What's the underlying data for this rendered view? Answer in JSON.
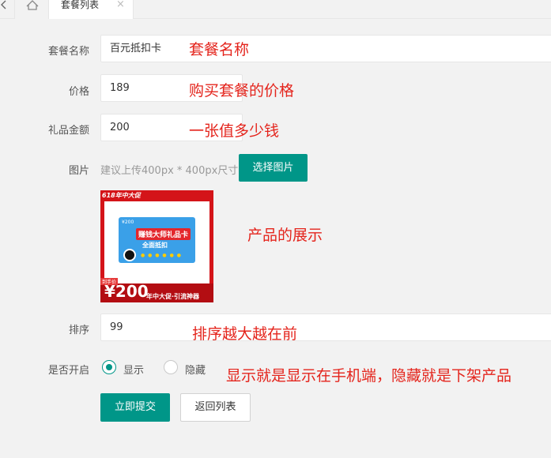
{
  "tabs": {
    "active_label": "套餐列表",
    "close_glyph": "×"
  },
  "form": {
    "name": {
      "label": "套餐名称",
      "value": "百元抵扣卡",
      "note": "套餐名称"
    },
    "price": {
      "label": "价格",
      "value": "189",
      "note": "购买套餐的价格"
    },
    "gift_amount": {
      "label": "礼品金额",
      "value": "200",
      "note": "一张值多少钱"
    },
    "image": {
      "label": "图片",
      "hint": "建议上传400px * 400px尺寸",
      "button": "选择图片",
      "note": "产品的展示",
      "preview": {
        "top_tag": "618年中大促",
        "card_small": "¥200",
        "card_title": "赚钱大师礼品卡",
        "card_sub": "全面抵扣",
        "dots": "● ● ● ● ● ●",
        "price_tag": "到手价",
        "price": "¥200",
        "bottom_text": "年中大促·引流神器"
      }
    },
    "sort": {
      "label": "排序",
      "value": "99",
      "note": "排序越大越在前"
    },
    "enabled": {
      "label": "是否开启",
      "options": [
        "显示",
        "隐藏"
      ],
      "selected": "显示",
      "note": "显示就是显示在手机端，隐藏就是下架产品"
    },
    "submit_button": "立即提交",
    "back_button": "返回列表"
  },
  "colors": {
    "primary": "#009688",
    "annotation": "#e4241c"
  }
}
